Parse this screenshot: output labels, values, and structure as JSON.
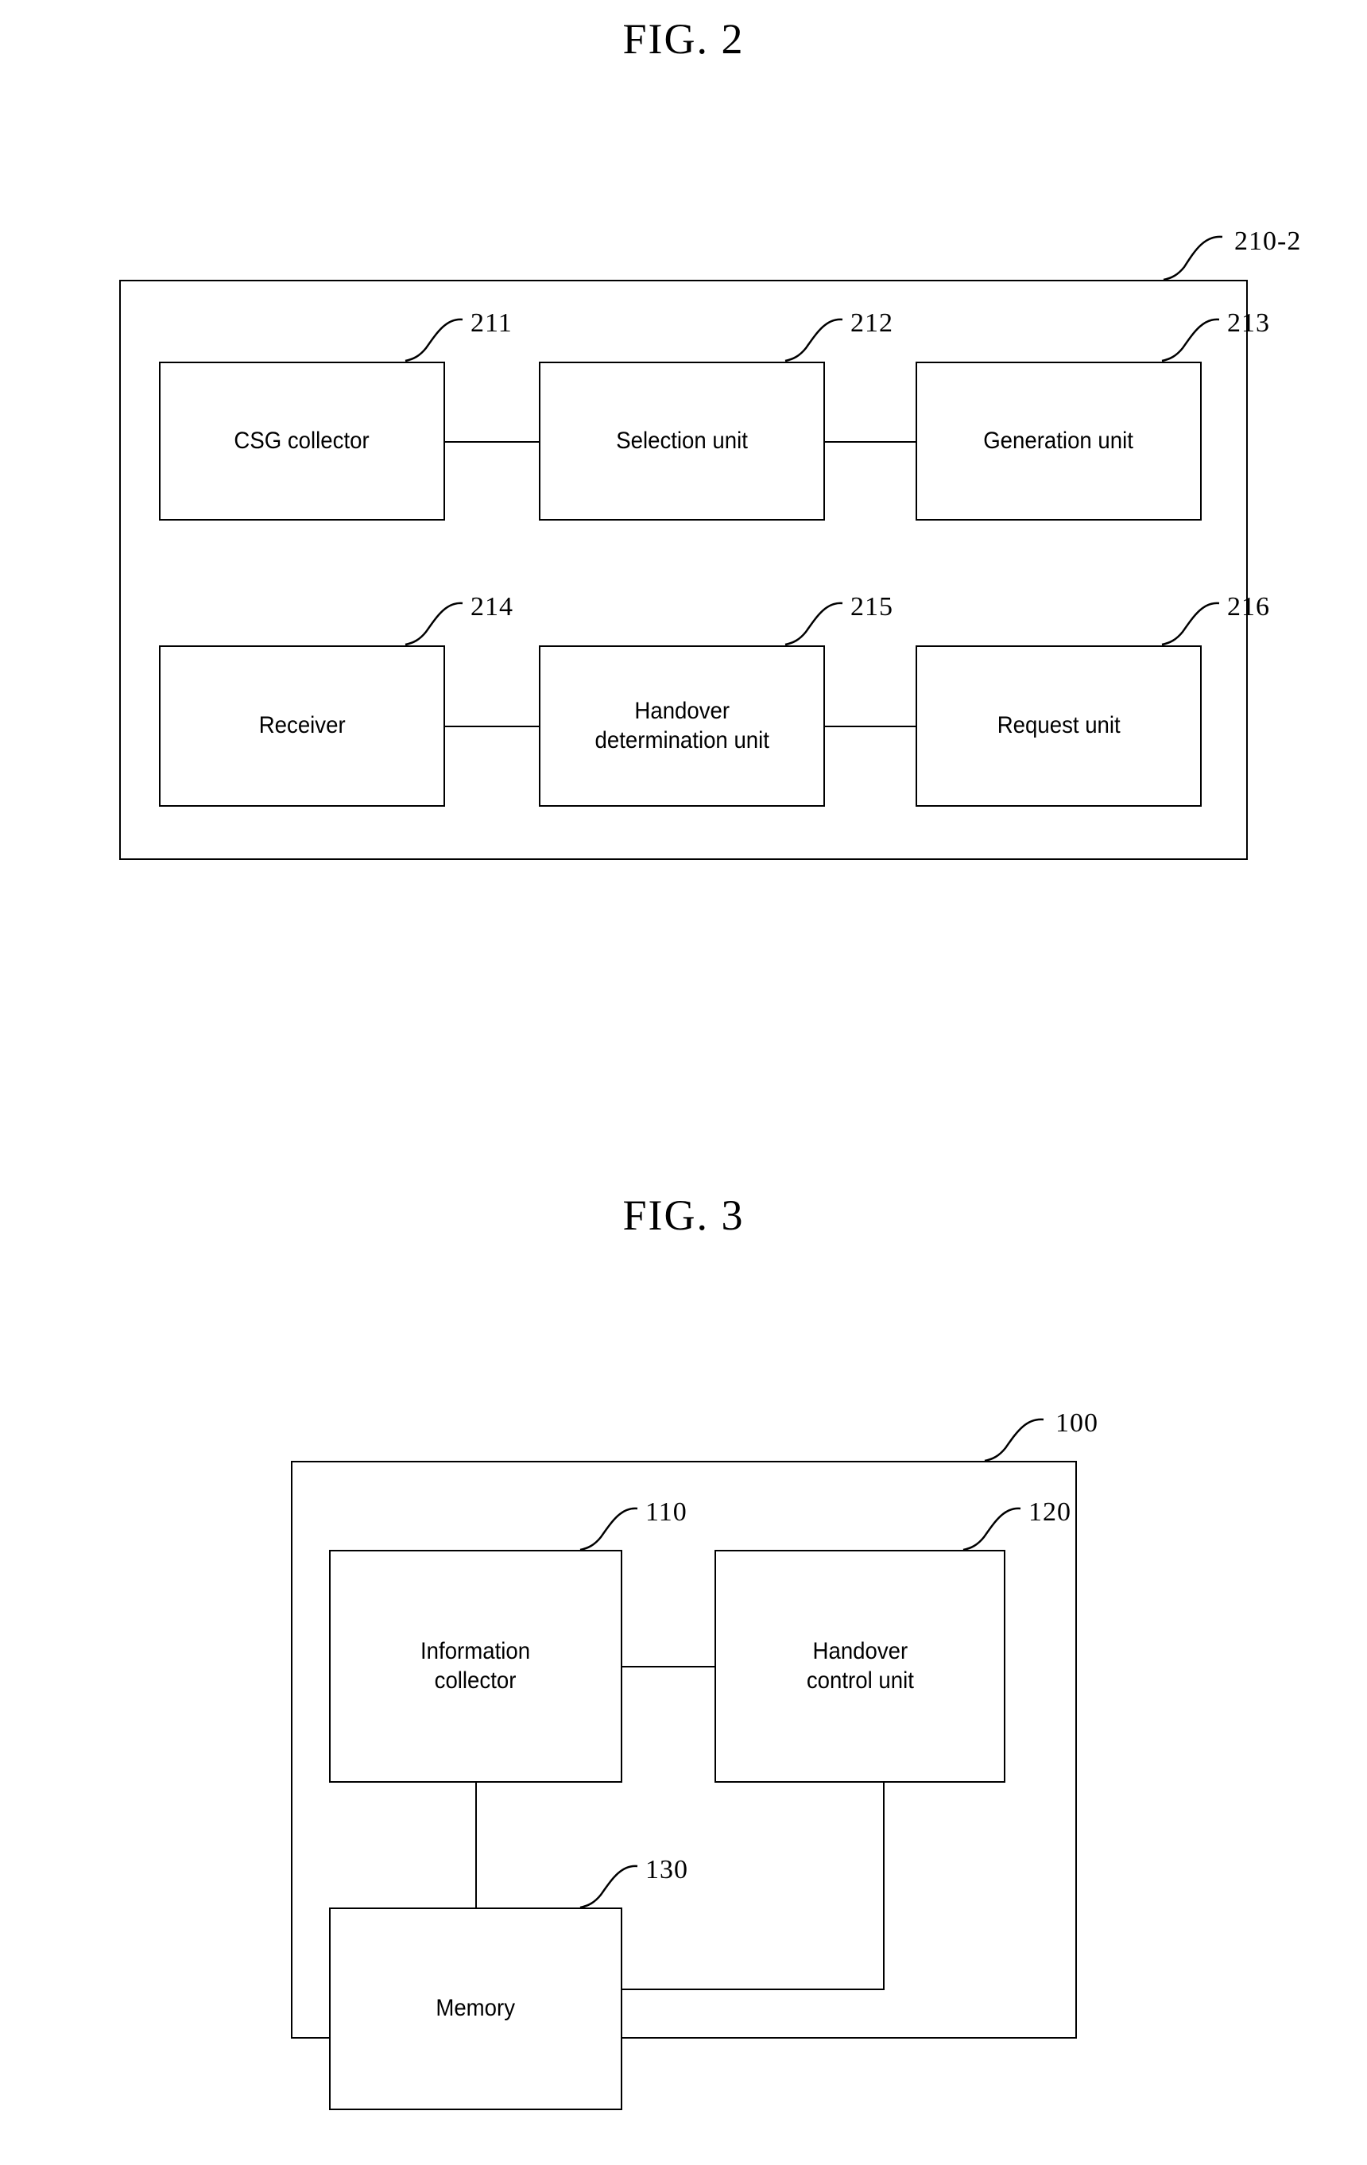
{
  "figures": [
    {
      "title": "FIG. 2",
      "outer_ref": "210-2",
      "units": [
        {
          "ref": "211",
          "label": "CSG collector"
        },
        {
          "ref": "212",
          "label": "Selection unit"
        },
        {
          "ref": "213",
          "label": "Generation unit"
        },
        {
          "ref": "214",
          "label": "Receiver"
        },
        {
          "ref": "215",
          "label": "Handover\ndetermination unit"
        },
        {
          "ref": "216",
          "label": "Request unit"
        }
      ]
    },
    {
      "title": "FIG. 3",
      "outer_ref": "100",
      "units": [
        {
          "ref": "110",
          "label": "Information\ncollector"
        },
        {
          "ref": "120",
          "label": "Handover\ncontrol unit"
        },
        {
          "ref": "130",
          "label": "Memory"
        }
      ]
    }
  ],
  "colors": {
    "line": "#000000",
    "background": "#ffffff"
  }
}
